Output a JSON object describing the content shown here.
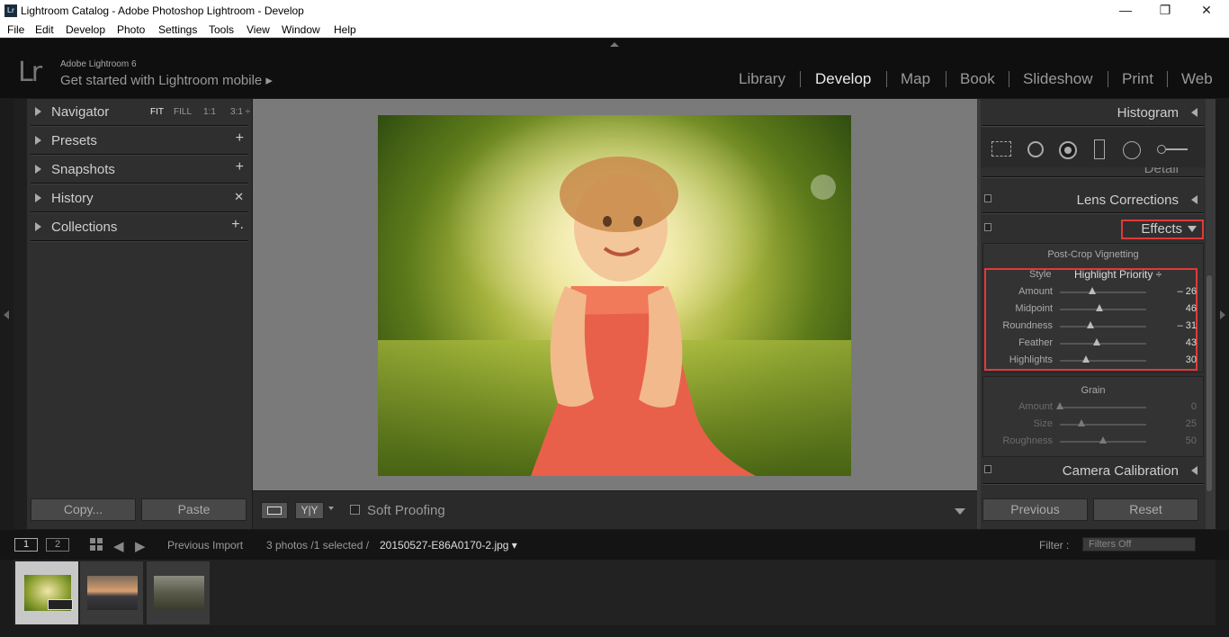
{
  "window": {
    "app_icon": "Lr",
    "title": "Lightroom Catalog - Adobe Photoshop Lightroom - Develop",
    "min_icon": "—",
    "restore_icon": "❐",
    "close_icon": "✕"
  },
  "menu": [
    "File",
    "Edit",
    "Develop",
    "Photo",
    "Settings",
    "Tools",
    "View",
    "Window",
    "Help"
  ],
  "identity": {
    "logo": "Lr",
    "version": "Adobe Lightroom 6",
    "mobile": "Get started with Lightroom mobile ▸"
  },
  "modules": [
    "Library",
    "Develop",
    "Map",
    "Book",
    "Slideshow",
    "Print",
    "Web"
  ],
  "active_module": "Develop",
  "left_panel": {
    "navigator": "Navigator",
    "nav_options": [
      "FIT",
      "FILL",
      "1:1",
      "3:1 ÷"
    ],
    "presets": "Presets",
    "snapshots": "Snapshots",
    "history": "History",
    "collections": "Collections",
    "plus": "+",
    "close_x": "✕",
    "collections_plus": "+.",
    "copy_button": "Copy...",
    "paste_button": "Paste"
  },
  "toolbar": {
    "view_yy": "Y|Y",
    "soft_proofing": "Soft Proofing"
  },
  "right_panel": {
    "histogram": "Histogram",
    "detail": "Detail",
    "lens_corrections": "Lens Corrections",
    "effects": "Effects",
    "post_crop_vignetting": "Post-Crop Vignetting",
    "style_label": "Style",
    "style_value": "Highlight Priority ÷",
    "vignette": [
      {
        "name": "Amount",
        "value": "– 26",
        "level": 0.37
      },
      {
        "name": "Midpoint",
        "value": "46",
        "level": 0.46
      },
      {
        "name": "Roundness",
        "value": "– 31",
        "level": 0.35
      },
      {
        "name": "Feather",
        "value": "43",
        "level": 0.43
      },
      {
        "name": "Highlights",
        "value": "30",
        "level": 0.3
      }
    ],
    "grain": "Grain",
    "grain_sliders": [
      {
        "name": "Amount",
        "value": "0",
        "level": 0.0
      },
      {
        "name": "Size",
        "value": "25",
        "level": 0.25
      },
      {
        "name": "Roughness",
        "value": "50",
        "level": 0.5
      }
    ],
    "camera_calibration": "Camera Calibration",
    "previous_button": "Previous",
    "reset_button": "Reset"
  },
  "filmstrip": {
    "screen1": "1",
    "screen2": "2",
    "source": "Previous Import",
    "count": "3 photos /1 selected /",
    "filename": "20150527-E86A0170-2.jpg ▾",
    "filter_label": "Filter :",
    "filter_value": "Filters Off"
  },
  "colors": {
    "accent_red": "#e03a3a",
    "panel_bg": "#2f2f2f",
    "background": "#7a7a7a"
  }
}
